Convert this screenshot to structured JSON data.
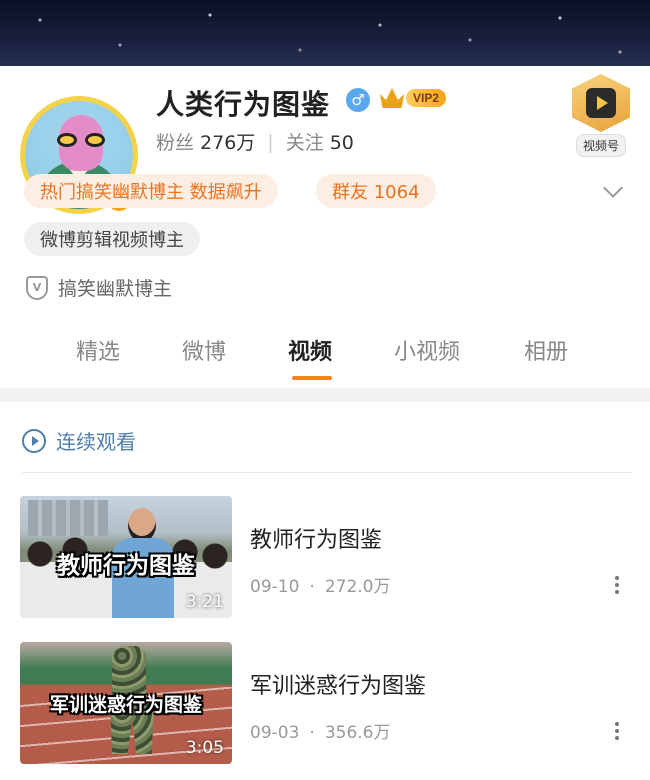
{
  "profile": {
    "nickname": "人类行为图鉴",
    "verified_badge": "V",
    "gender_symbol": "♂",
    "vip_label": "VIP2",
    "fans_label": "粉丝",
    "fans_count": "276万",
    "following_label": "关注",
    "following_count": "50",
    "channel_label": "视频号"
  },
  "tags": {
    "hot": "热门搞笑幽默博主 数据飙升",
    "group": "群友 1064",
    "category": "微博剪辑视频博主",
    "certification": "搞笑幽默博主"
  },
  "tabs": [
    "精选",
    "微博",
    "视频",
    "小视频",
    "相册"
  ],
  "active_tab": "视频",
  "accent_color": "#f5821f",
  "continuous_play": "连续观看",
  "videos": [
    {
      "thumb_caption": "教师行为图鉴",
      "duration": "3:21",
      "title": "教师行为图鉴",
      "date": "09-10",
      "views": "272.0万"
    },
    {
      "thumb_caption": "军训迷惑行为图鉴",
      "duration": "3:05",
      "title": "军训迷惑行为图鉴",
      "date": "09-03",
      "views": "356.6万"
    }
  ]
}
